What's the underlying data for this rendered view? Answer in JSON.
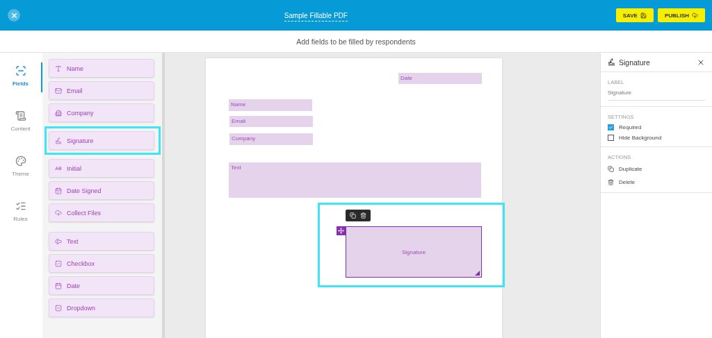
{
  "header": {
    "title": "Sample Fillable PDF",
    "buttons": [
      {
        "label": "SAVE",
        "kind": "save"
      },
      {
        "label": "PUBLISH",
        "kind": "publish"
      }
    ]
  },
  "subheader": "Add fields to be filled by respondents",
  "nav": [
    {
      "label": "Fields",
      "selected": true
    },
    {
      "label": "Content",
      "selected": false
    },
    {
      "label": "Theme",
      "selected": false
    },
    {
      "label": "Rules",
      "selected": false
    }
  ],
  "palette": {
    "groups": [
      {
        "items": [
          {
            "label": "Name",
            "highlighted": false
          },
          {
            "label": "Email",
            "highlighted": false
          },
          {
            "label": "Company",
            "highlighted": false
          },
          {
            "label": "Signature",
            "highlighted": true
          },
          {
            "label": "Initial",
            "highlighted": false
          },
          {
            "label": "Date Signed",
            "highlighted": false
          },
          {
            "label": "Collect Files",
            "highlighted": false
          }
        ]
      },
      {
        "items": [
          {
            "label": "Text",
            "highlighted": false
          },
          {
            "label": "Checkbox",
            "highlighted": false
          },
          {
            "label": "Date",
            "highlighted": false
          },
          {
            "label": "Dropdown",
            "highlighted": false
          }
        ]
      }
    ]
  },
  "canvas_fields": [
    {
      "label": "Date",
      "kind": "line",
      "selected": false
    },
    {
      "label": "Name",
      "kind": "line",
      "selected": false
    },
    {
      "label": "Email",
      "kind": "line",
      "selected": false
    },
    {
      "label": "Company",
      "kind": "line",
      "selected": false
    },
    {
      "label": "Text",
      "kind": "area",
      "selected": false
    },
    {
      "label": "Signature",
      "kind": "signature",
      "selected": true
    }
  ],
  "properties": {
    "title": "Signature",
    "label": {
      "heading": "LABEL",
      "value": "Signature"
    },
    "settings": {
      "heading": "SETTINGS",
      "options": [
        {
          "label": "Required",
          "checked": true
        },
        {
          "label": "Hide Background",
          "checked": false
        }
      ]
    },
    "actions": {
      "heading": "ACTIONS",
      "items": [
        {
          "label": "Duplicate",
          "kind": "duplicate"
        },
        {
          "label": "Delete",
          "kind": "delete"
        }
      ]
    }
  }
}
